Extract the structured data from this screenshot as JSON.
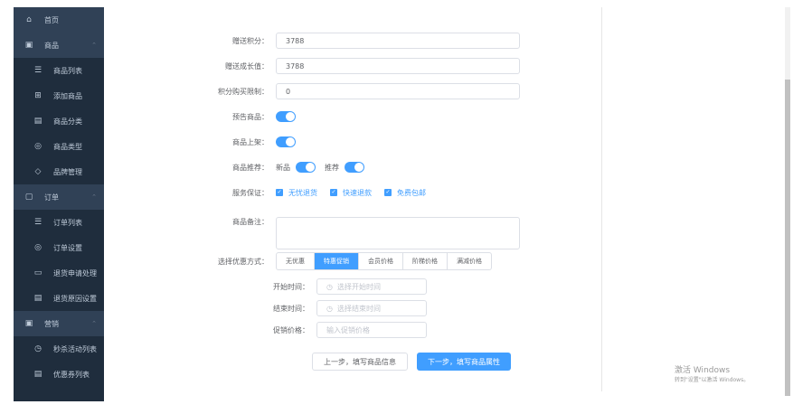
{
  "sidebar": {
    "home": "首页",
    "groups": [
      {
        "label": "商品",
        "items": [
          "商品列表",
          "添加商品",
          "商品分类",
          "商品类型",
          "品牌管理"
        ]
      },
      {
        "label": "订单",
        "items": [
          "订单列表",
          "订单设置",
          "退货申请处理",
          "退货原因设置"
        ]
      },
      {
        "label": "营销",
        "items": [
          "秒杀活动列表",
          "优惠券列表"
        ]
      }
    ]
  },
  "form": {
    "gift_points": {
      "label": "赠送积分：",
      "value": "3788"
    },
    "gift_growth": {
      "label": "赠送成长值：",
      "value": "3788"
    },
    "points_limit": {
      "label": "积分购买限制：",
      "value": "0"
    },
    "preview": {
      "label": "预告商品："
    },
    "publish": {
      "label": "商品上架："
    },
    "recommend": {
      "label": "商品推荐：",
      "new": "新品",
      "rec": "推荐"
    },
    "service": {
      "label": "服务保证：",
      "options": [
        "无忧退货",
        "快速退款",
        "免费包邮"
      ]
    },
    "note": {
      "label": "商品备注："
    },
    "promo": {
      "label": "选择优惠方式：",
      "tabs": [
        "无优惠",
        "特惠促销",
        "会员价格",
        "阶梯价格",
        "满减价格"
      ],
      "active": 1
    },
    "start": {
      "label": "开始时间：",
      "placeholder": "选择开始时间"
    },
    "end": {
      "label": "结束时间：",
      "placeholder": "选择结束时间"
    },
    "price": {
      "label": "促销价格：",
      "placeholder": "输入促销价格"
    },
    "prev_btn": "上一步，填写商品信息",
    "next_btn": "下一步，填写商品属性"
  },
  "watermark": {
    "title": "激活 Windows",
    "sub": "转到\"设置\"以激活 Windows。"
  }
}
